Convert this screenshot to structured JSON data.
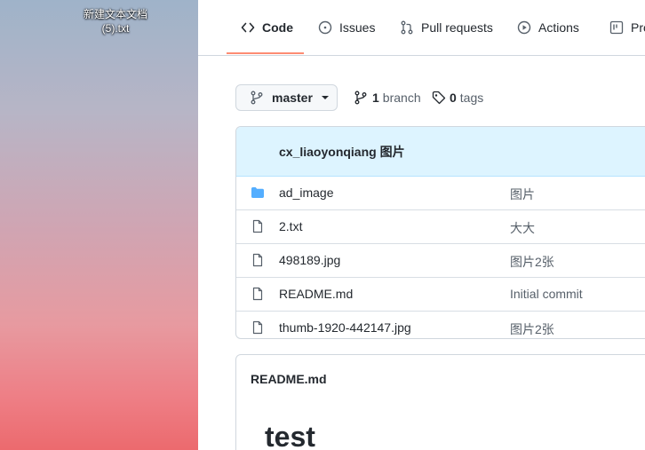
{
  "desktop": {
    "file_label_line1": "新建文本文档",
    "file_label_line2": "(5).txt"
  },
  "tabs": [
    {
      "label": "Code",
      "icon": "code-icon",
      "active": true
    },
    {
      "label": "Issues",
      "icon": "issue-icon"
    },
    {
      "label": "Pull requests",
      "icon": "pull-request-icon"
    },
    {
      "label": "Actions",
      "icon": "play-icon"
    },
    {
      "label": "Pro",
      "icon": "project-icon"
    }
  ],
  "repo": {
    "branch": "master",
    "branch_count": "1",
    "branch_word": "branch",
    "tag_count": "0",
    "tag_word": "tags"
  },
  "commit": {
    "text": "cx_liaoyonqiang 图片"
  },
  "files": [
    {
      "name": "ad_image",
      "type": "folder",
      "message": "图片"
    },
    {
      "name": "2.txt",
      "type": "file",
      "message": "大大"
    },
    {
      "name": "498189.jpg",
      "type": "file",
      "message": "图片2张"
    },
    {
      "name": "README.md",
      "type": "file",
      "message": "Initial commit"
    },
    {
      "name": "thumb-1920-442147.jpg",
      "type": "file",
      "message": "图片2张"
    }
  ],
  "readme": {
    "title": "README.md",
    "heading": "test"
  },
  "colors": {
    "tab_underline": "#fd8c73",
    "commit_bg": "#ddf4ff",
    "folder": "#54aeff"
  }
}
